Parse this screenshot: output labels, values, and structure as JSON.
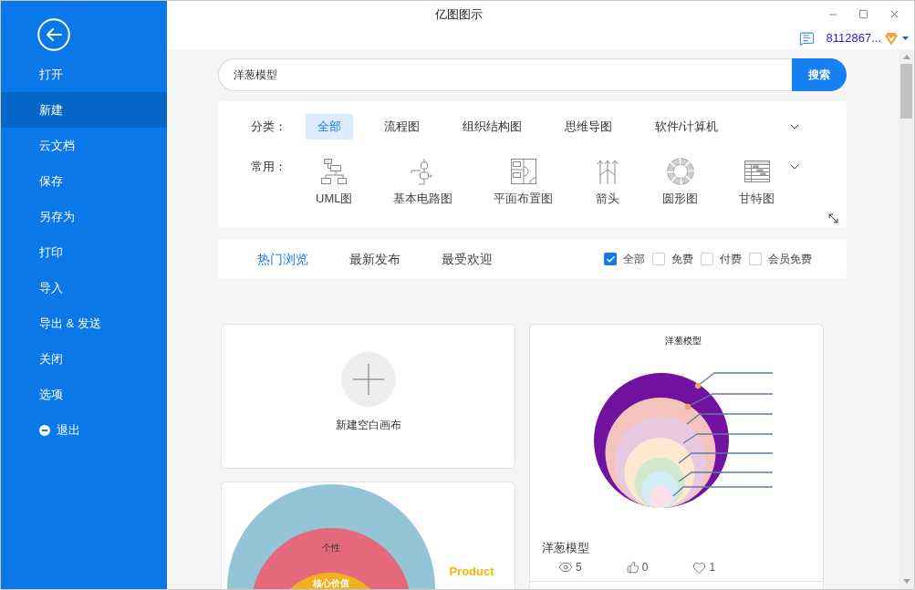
{
  "window": {
    "title": "亿图图示"
  },
  "account": {
    "user": "8112867..."
  },
  "sidebar": {
    "items": [
      {
        "label": "打开",
        "selected": false,
        "kind": "entry"
      },
      {
        "label": "新建",
        "selected": true,
        "kind": "entry"
      },
      {
        "label": "云文档",
        "selected": false,
        "kind": "entry"
      },
      {
        "label": "保存",
        "selected": false,
        "kind": "entry"
      },
      {
        "label": "另存为",
        "selected": false,
        "kind": "entry"
      },
      {
        "label": "打印",
        "selected": false,
        "kind": "entry"
      },
      {
        "label": "导入",
        "selected": false,
        "kind": "entry"
      },
      {
        "label": "导出 & 发送",
        "selected": false,
        "kind": "entry"
      },
      {
        "label": "关闭",
        "selected": false,
        "kind": "entry"
      },
      {
        "label": "选项",
        "selected": false,
        "kind": "entry"
      },
      {
        "label": "退出",
        "selected": false,
        "kind": "exit"
      }
    ]
  },
  "search": {
    "value": "洋葱模型",
    "button": "搜索"
  },
  "categories": {
    "label": "分类：",
    "items": [
      {
        "label": "全部",
        "selected": true
      },
      {
        "label": "流程图",
        "selected": false
      },
      {
        "label": "组织结构图",
        "selected": false
      },
      {
        "label": "思维导图",
        "selected": false
      },
      {
        "label": "软件/计算机",
        "selected": false
      }
    ]
  },
  "common": {
    "label": "常用：",
    "items": [
      "UML图",
      "基本电路图",
      "平面布置图",
      "箭头",
      "圆形图",
      "甘特图"
    ]
  },
  "tabs": [
    {
      "label": "热门浏览",
      "selected": true
    },
    {
      "label": "最新发布",
      "selected": false
    },
    {
      "label": "最受欢迎",
      "selected": false
    }
  ],
  "filters": [
    {
      "label": "全部",
      "checked": true
    },
    {
      "label": "免费",
      "checked": false
    },
    {
      "label": "付费",
      "checked": false
    },
    {
      "label": "会员免费",
      "checked": false
    }
  ],
  "gallery": {
    "columns": [
      {
        "cards": [
          {
            "kind": "blank",
            "label": "新建空白画布"
          },
          {
            "kind": "template",
            "preview": {
              "kind": "half-rings",
              "labels": [
                "个性",
                "核心价值"
              ],
              "title": "Product"
            }
          }
        ]
      },
      {
        "cards": [
          {
            "kind": "template",
            "preview": {
              "kind": "onion",
              "title": "洋葱模型"
            },
            "name": "洋葱模型",
            "views": "5",
            "likes": "0",
            "favorites": "1"
          }
        ]
      }
    ]
  }
}
